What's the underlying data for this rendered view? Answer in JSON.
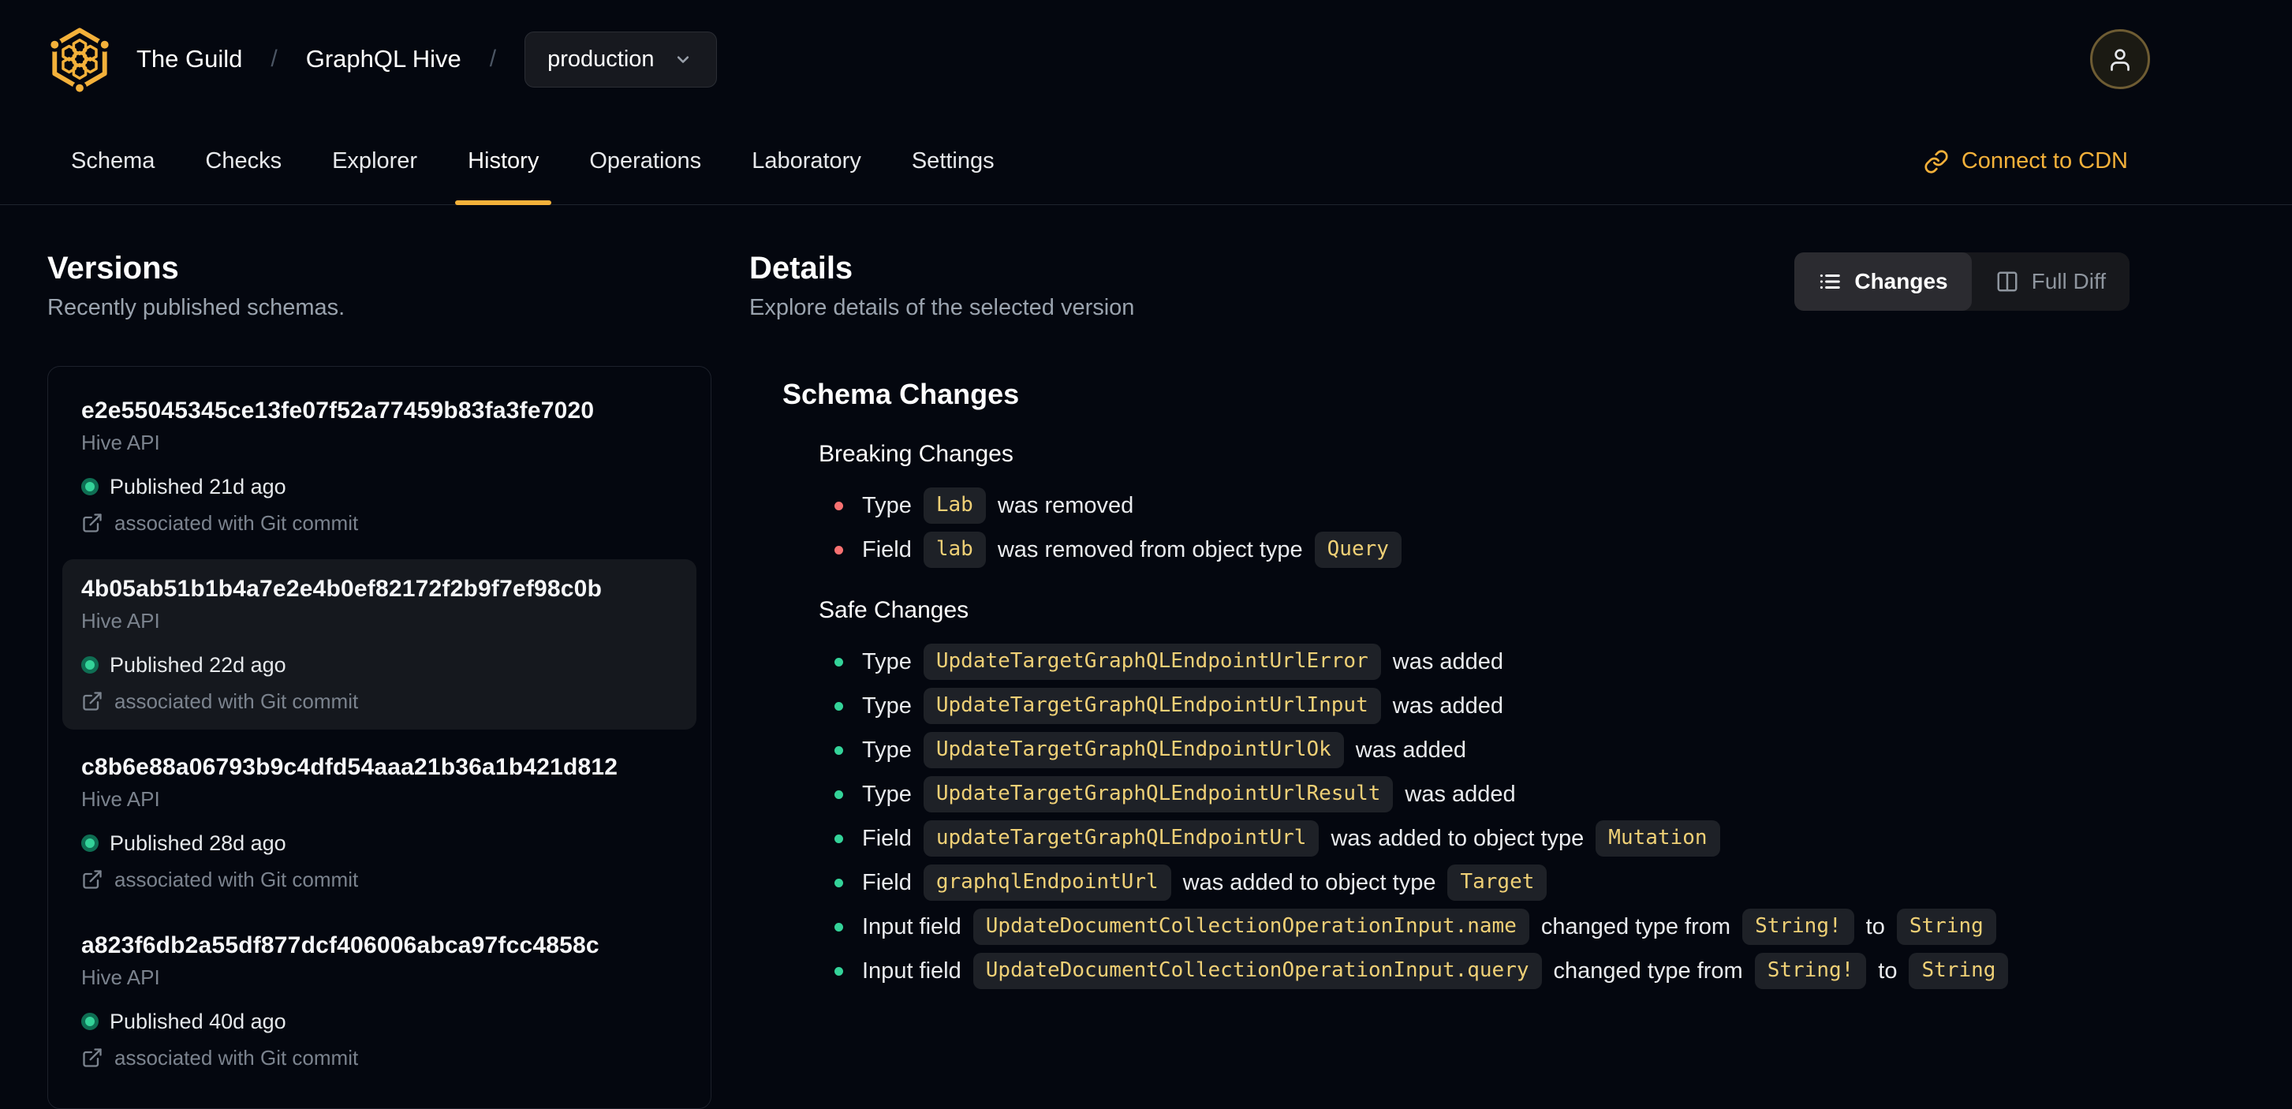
{
  "colors": {
    "background": "#04070f",
    "accent": "#f4b13a",
    "code_text": "#efd076",
    "chip_background": "#1e2127",
    "breaking_bullet": "#f87171",
    "safe_bullet": "#34d399",
    "border": "#1f242e",
    "selected_item_background": "#15181e"
  },
  "header": {
    "org": "The Guild",
    "separator": "/",
    "project": "GraphQL Hive",
    "target_selector": {
      "value": "production"
    },
    "avatar_icon": "person-icon"
  },
  "nav": {
    "tabs": [
      {
        "label": "Schema"
      },
      {
        "label": "Checks"
      },
      {
        "label": "Explorer"
      },
      {
        "label": "History"
      },
      {
        "label": "Operations"
      },
      {
        "label": "Laboratory"
      },
      {
        "label": "Settings"
      }
    ],
    "active_tab": "History",
    "cdn_link": "Connect to CDN"
  },
  "versions_panel": {
    "title": "Versions",
    "subtitle": "Recently published schemas.",
    "items": [
      {
        "hash": "e2e55045345ce13fe07f52a77459b83fa3fe7020",
        "service": "Hive API",
        "status": "Published 21d ago",
        "git": "associated with Git commit",
        "selected": false
      },
      {
        "hash": "4b05ab51b1b4a7e2e4b0ef82172f2b9f7ef98c0b",
        "service": "Hive API",
        "status": "Published 22d ago",
        "git": "associated with Git commit",
        "selected": true
      },
      {
        "hash": "c8b6e88a06793b9c4dfd54aaa21b36a1b421d812",
        "service": "Hive API",
        "status": "Published 28d ago",
        "git": "associated with Git commit",
        "selected": false
      },
      {
        "hash": "a823f6db2a55df877dcf406006abca97fcc4858c",
        "service": "Hive API",
        "status": "Published 40d ago",
        "git": "associated with Git commit",
        "selected": false
      }
    ]
  },
  "details_panel": {
    "title": "Details",
    "subtitle": "Explore details of the selected version",
    "view_toggle": {
      "changes_label": "Changes",
      "full_diff_label": "Full Diff",
      "active": "Changes"
    },
    "schema_changes": {
      "title": "Schema Changes",
      "groups": [
        {
          "name": "Breaking Changes",
          "severity": "breaking",
          "rows": [
            {
              "parts": [
                {
                  "type": "text",
                  "value": "Type"
                },
                {
                  "type": "code",
                  "value": "Lab"
                },
                {
                  "type": "text",
                  "value": "was removed"
                }
              ]
            },
            {
              "parts": [
                {
                  "type": "text",
                  "value": "Field"
                },
                {
                  "type": "code",
                  "value": "lab"
                },
                {
                  "type": "text",
                  "value": "was removed from object type"
                },
                {
                  "type": "code",
                  "value": "Query"
                }
              ]
            }
          ]
        },
        {
          "name": "Safe Changes",
          "severity": "safe",
          "rows": [
            {
              "parts": [
                {
                  "type": "text",
                  "value": "Type"
                },
                {
                  "type": "code",
                  "value": "UpdateTargetGraphQLEndpointUrlError"
                },
                {
                  "type": "text",
                  "value": "was added"
                }
              ]
            },
            {
              "parts": [
                {
                  "type": "text",
                  "value": "Type"
                },
                {
                  "type": "code",
                  "value": "UpdateTargetGraphQLEndpointUrlInput"
                },
                {
                  "type": "text",
                  "value": "was added"
                }
              ]
            },
            {
              "parts": [
                {
                  "type": "text",
                  "value": "Type"
                },
                {
                  "type": "code",
                  "value": "UpdateTargetGraphQLEndpointUrlOk"
                },
                {
                  "type": "text",
                  "value": "was added"
                }
              ]
            },
            {
              "parts": [
                {
                  "type": "text",
                  "value": "Type"
                },
                {
                  "type": "code",
                  "value": "UpdateTargetGraphQLEndpointUrlResult"
                },
                {
                  "type": "text",
                  "value": "was added"
                }
              ]
            },
            {
              "parts": [
                {
                  "type": "text",
                  "value": "Field"
                },
                {
                  "type": "code",
                  "value": "updateTargetGraphQLEndpointUrl"
                },
                {
                  "type": "text",
                  "value": "was added to object type"
                },
                {
                  "type": "code",
                  "value": "Mutation"
                }
              ]
            },
            {
              "parts": [
                {
                  "type": "text",
                  "value": "Field"
                },
                {
                  "type": "code",
                  "value": "graphqlEndpointUrl"
                },
                {
                  "type": "text",
                  "value": "was added to object type"
                },
                {
                  "type": "code",
                  "value": "Target"
                }
              ]
            },
            {
              "parts": [
                {
                  "type": "text",
                  "value": "Input field"
                },
                {
                  "type": "code",
                  "value": "UpdateDocumentCollectionOperationInput.name"
                },
                {
                  "type": "text",
                  "value": "changed type from"
                },
                {
                  "type": "code",
                  "value": "String!"
                },
                {
                  "type": "text",
                  "value": "to"
                },
                {
                  "type": "code",
                  "value": "String"
                }
              ]
            },
            {
              "parts": [
                {
                  "type": "text",
                  "value": "Input field"
                },
                {
                  "type": "code",
                  "value": "UpdateDocumentCollectionOperationInput.query"
                },
                {
                  "type": "text",
                  "value": "changed type from"
                },
                {
                  "type": "code",
                  "value": "String!"
                },
                {
                  "type": "text",
                  "value": "to"
                },
                {
                  "type": "code",
                  "value": "String"
                }
              ]
            }
          ]
        }
      ]
    }
  }
}
